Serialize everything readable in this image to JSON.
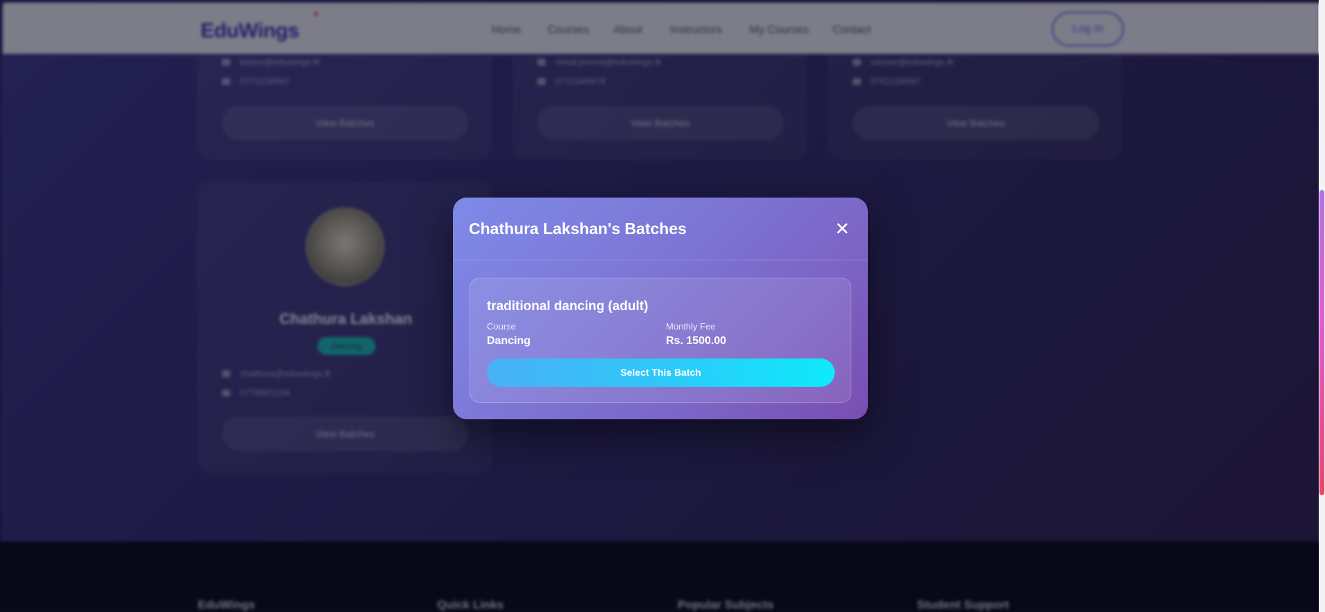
{
  "navbar": {
    "brand": "EduWings",
    "links": [
      "Home",
      "Courses",
      "About",
      "Instructors",
      "My Courses",
      "Contact"
    ],
    "login_label": "Log In"
  },
  "cards": [
    {
      "email": "kasun@eduwings.lk",
      "phone": "0771234567",
      "button": "View Batches"
    },
    {
      "email": "nimal.perera@eduwings.lk",
      "phone": "0712345678",
      "button": "View Batches"
    },
    {
      "email": "saman@eduwings.lk",
      "phone": "0761234567",
      "button": "View Batches"
    }
  ],
  "teacher": {
    "name": "Chathura Lakshan",
    "badge": "Dancing",
    "email": "chathura@eduwings.lk",
    "phone": "0778901234",
    "button": "View Batches"
  },
  "footer": {
    "columns": [
      "EduWings",
      "Quick Links",
      "Popular Subjects",
      "Student Support"
    ]
  },
  "modal": {
    "title": "Chathura Lakshan's Batches",
    "close_symbol": "✕",
    "batch": {
      "name": "traditional dancing (adult)",
      "course_label": "Course",
      "course_value": "Dancing",
      "fee_label": "Monthly Fee",
      "fee_value": "Rs. 1500.00",
      "select_label": "Select This Batch"
    }
  },
  "colors": {
    "accent_start": "#4ab0f6",
    "accent_end": "#0eeafb",
    "modal_start": "#7e8ae8",
    "modal_end": "#7a4db0"
  }
}
